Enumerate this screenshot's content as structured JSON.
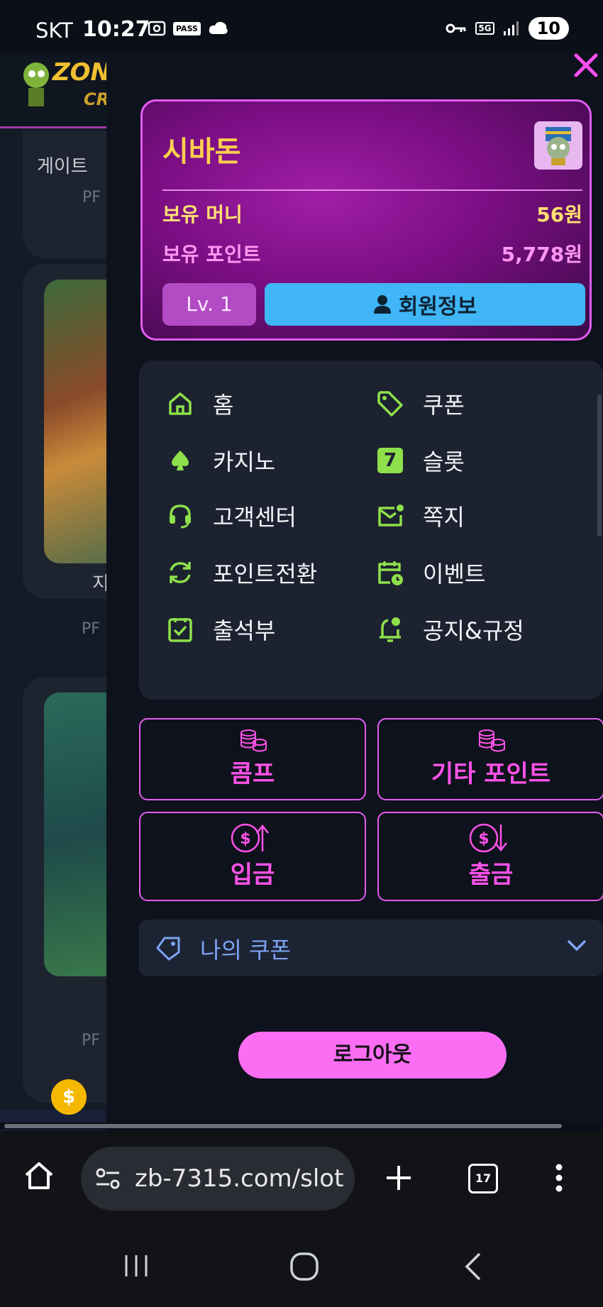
{
  "status_bar": {
    "carrier": "SKT",
    "time": "10:27",
    "pass_label": "PASS",
    "network": "5G",
    "battery": "10"
  },
  "background_page": {
    "logo_line1": "ZON",
    "logo_line2": "CR",
    "card1_title": "게이트",
    "card1_provider": "PF",
    "card2_title": "지",
    "card2_provider": "PF",
    "card3_provider": "PF",
    "coin_symbol": "$"
  },
  "profile": {
    "name": "시바돈",
    "money_label": "보유 머니",
    "money_value": "56원",
    "points_label": "보유 포인트",
    "points_value": "5,778원",
    "level": "Lv. 1",
    "member_info_label": "회원정보"
  },
  "menu": {
    "items": [
      {
        "label": "홈",
        "icon": "home-icon"
      },
      {
        "label": "쿠폰",
        "icon": "tag-icon"
      },
      {
        "label": "카지노",
        "icon": "spade-icon"
      },
      {
        "label": "슬롯",
        "icon": "seven-icon"
      },
      {
        "label": "고객센터",
        "icon": "headset-icon"
      },
      {
        "label": "쪽지",
        "icon": "mail-icon"
      },
      {
        "label": "포인트전환",
        "icon": "refresh-icon"
      },
      {
        "label": "이벤트",
        "icon": "calendar-icon"
      },
      {
        "label": "출석부",
        "icon": "checklist-icon"
      },
      {
        "label": "공지&규정",
        "icon": "bell-icon"
      }
    ],
    "seven_glyph": "7"
  },
  "actions": {
    "comp": "콤프",
    "other_points": "기타 포인트",
    "deposit": "입금",
    "withdraw": "출금"
  },
  "coupon": {
    "label": "나의 쿠폰"
  },
  "logout_label": "로그아웃",
  "browser": {
    "url": "zb-7315.com/slot",
    "tab_count": "17"
  },
  "colors": {
    "accent_pink": "#ff52e8",
    "accent_green": "#8ee04a",
    "member_blue": "#41b6f7",
    "gold": "#ffd04d"
  }
}
